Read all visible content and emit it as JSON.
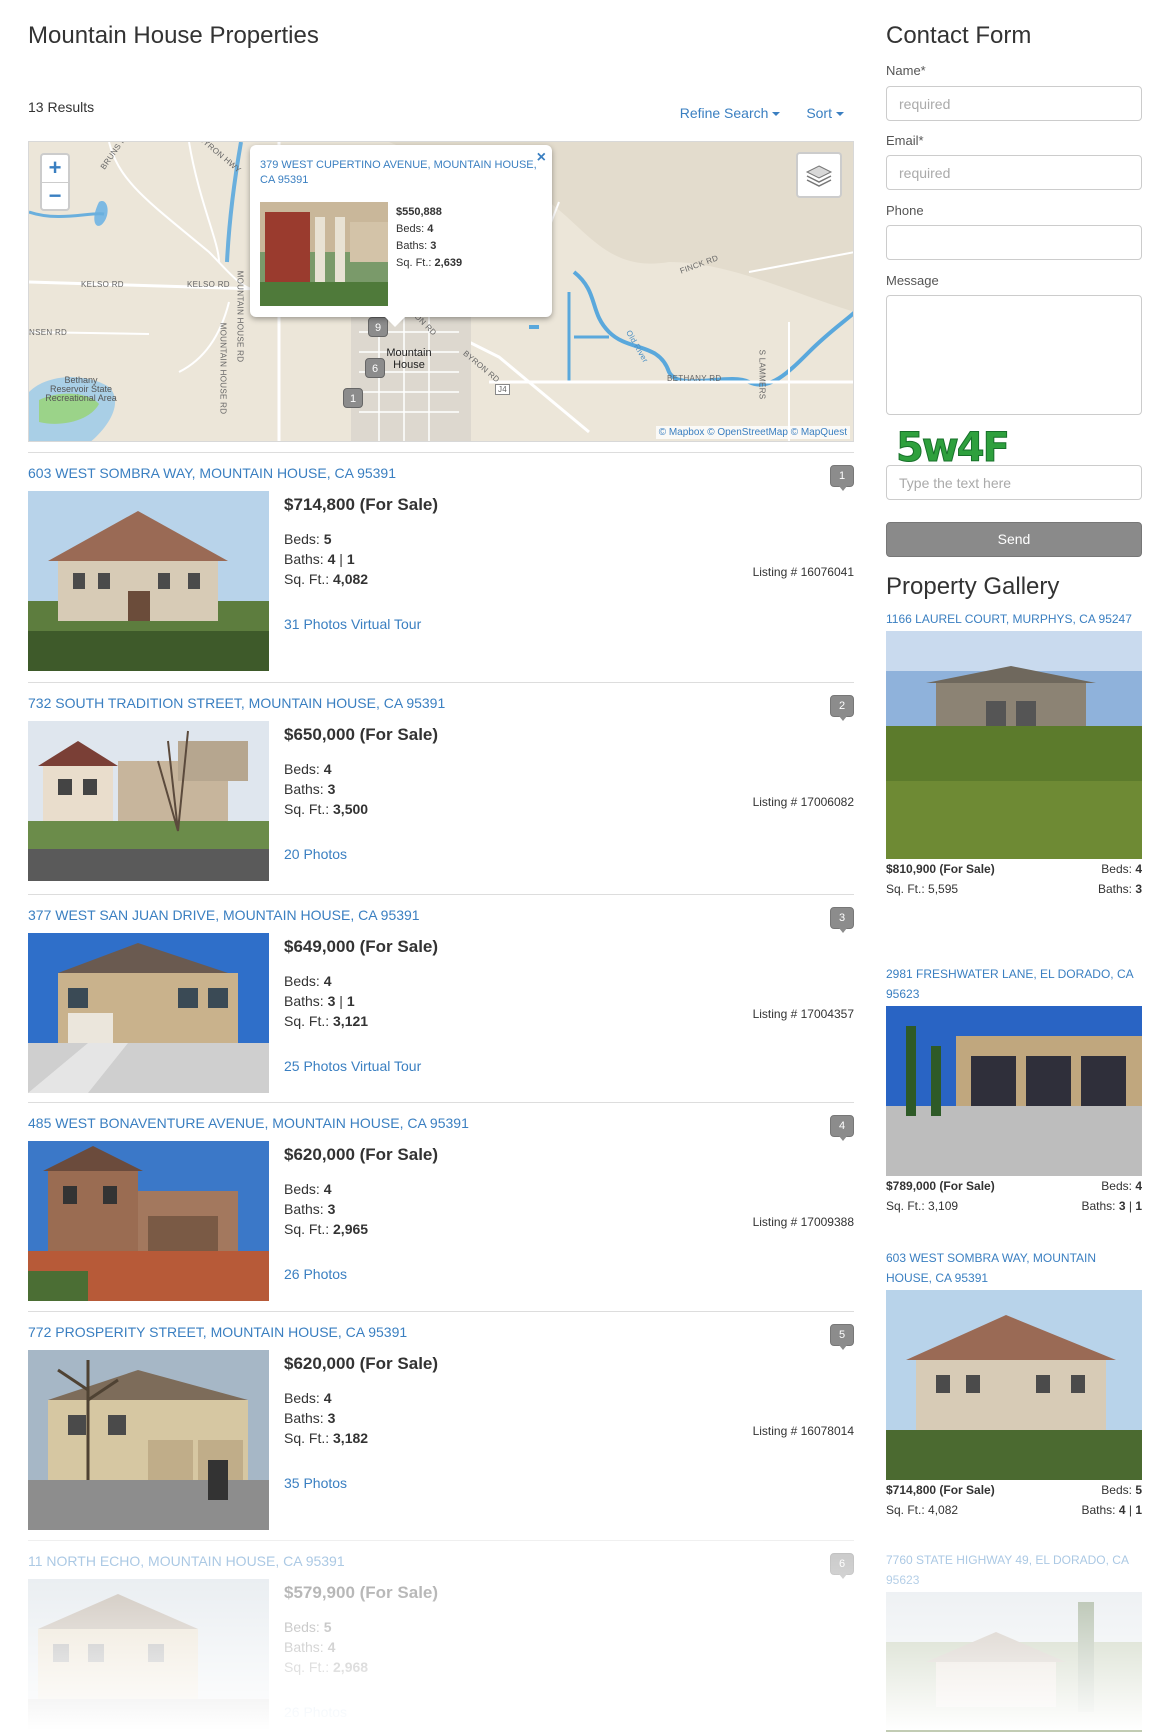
{
  "page": {
    "title": "Mountain House Properties",
    "results": "13 Results",
    "refine_label": "Refine Search",
    "sort_label": "Sort"
  },
  "map": {
    "zoom_in": "+",
    "zoom_out": "−",
    "roads": [
      "BRUNS RD",
      "BYRON HWY",
      "KELSO RD",
      "KELSO RD",
      "NSEN RD",
      "MOUNTAIN HOUSE RD",
      "MOUNTAIN HOUSE RD",
      "BYRON RD",
      "BYRON RD",
      "FINCK RD",
      "BETHANY RD",
      "S LAMMERS",
      "RD",
      "J4"
    ],
    "places": [
      "Bethany Reservoir State Recreational Area",
      "Mountain House"
    ],
    "river": "Old River",
    "clusters": [
      "9",
      "6",
      "1"
    ],
    "attribution": "© Mapbox © OpenStreetMap © MapQuest",
    "popup": {
      "address": "379 WEST CUPERTINO AVENUE, MOUNTAIN HOUSE, CA 95391",
      "close": "×",
      "price": "$550,888",
      "beds_label": "Beds:",
      "beds": "4",
      "baths_label": "Baths:",
      "baths": "3",
      "sqft_label": "Sq. Ft.:",
      "sqft": "2,639"
    }
  },
  "listings": [
    {
      "num": "1",
      "address": "603 WEST SOMBRA WAY, MOUNTAIN HOUSE, CA 95391",
      "price": "$714,800 (For Sale)",
      "beds": "5",
      "baths": "4",
      "baths_half": "1",
      "sqft": "4,082",
      "listing_no": "Listing # 16076041",
      "photos": "31 Photos Virtual Tour"
    },
    {
      "num": "2",
      "address": "732 SOUTH TRADITION STREET, MOUNTAIN HOUSE, CA 95391",
      "price": "$650,000 (For Sale)",
      "beds": "4",
      "baths": "3",
      "baths_half": "",
      "sqft": "3,500",
      "listing_no": "Listing # 17006082",
      "photos": "20 Photos"
    },
    {
      "num": "3",
      "address": "377 WEST SAN JUAN DRIVE, MOUNTAIN HOUSE, CA 95391",
      "price": "$649,000 (For Sale)",
      "beds": "4",
      "baths": "3",
      "baths_half": "1",
      "sqft": "3,121",
      "listing_no": "Listing # 17004357",
      "photos": "25 Photos Virtual Tour"
    },
    {
      "num": "4",
      "address": "485 WEST BONAVENTURE AVENUE, MOUNTAIN HOUSE, CA 95391",
      "price": "$620,000 (For Sale)",
      "beds": "4",
      "baths": "3",
      "baths_half": "",
      "sqft": "2,965",
      "listing_no": "Listing # 17009388",
      "photos": "26 Photos"
    },
    {
      "num": "5",
      "address": "772 PROSPERITY STREET, MOUNTAIN HOUSE, CA 95391",
      "price": "$620,000 (For Sale)",
      "beds": "4",
      "baths": "3",
      "baths_half": "",
      "sqft": "3,182",
      "listing_no": "Listing # 16078014",
      "photos": "35 Photos"
    },
    {
      "num": "6",
      "address": "11 NORTH ECHO, MOUNTAIN HOUSE, CA 95391",
      "price": "$579,900 (For Sale)",
      "beds": "5",
      "baths": "4",
      "baths_half": "",
      "sqft": "2,968",
      "listing_no": "",
      "photos": "26 Photos"
    }
  ],
  "labels": {
    "beds": "Beds:",
    "baths": "Baths:",
    "sqft": "Sq. Ft.:",
    "half_sep": " | "
  },
  "contact": {
    "title": "Contact Form",
    "name_label": "Name*",
    "email_label": "Email*",
    "phone_label": "Phone",
    "message_label": "Message",
    "required_placeholder": "required",
    "captcha_text": "5w4F",
    "captcha_placeholder": "Type the text here",
    "send": "Send"
  },
  "gallery": {
    "title": "Property Gallery",
    "items": [
      {
        "address": "1166 LAUREL COURT, MURPHYS, CA 95247",
        "price": "$810,900 (For Sale)",
        "beds": "4",
        "sqft": "5,595",
        "baths": "3",
        "baths_half": ""
      },
      {
        "address": "2981 FRESHWATER LANE, EL DORADO, CA 95623",
        "price": "$789,000 (For Sale)",
        "beds": "4",
        "sqft": "3,109",
        "baths": "3",
        "baths_half": "1"
      },
      {
        "address": "603 WEST SOMBRA WAY, MOUNTAIN HOUSE, CA 95391",
        "price": "$714,800 (For Sale)",
        "beds": "5",
        "sqft": "4,082",
        "baths": "4",
        "baths_half": "1"
      },
      {
        "address": "7760 STATE HIGHWAY 49, EL DORADO, CA 95623",
        "price": "",
        "beds": "",
        "sqft": "",
        "baths": "",
        "baths_half": ""
      }
    ]
  }
}
